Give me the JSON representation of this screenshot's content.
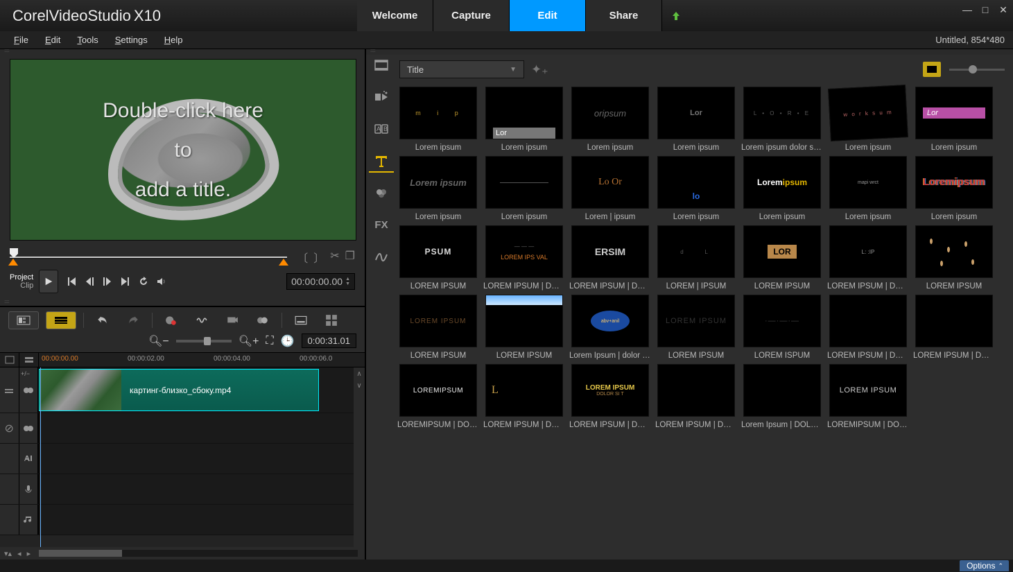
{
  "app": {
    "brand": "Corel",
    "name1": "Video",
    "name2": "Studio",
    "version": "X10"
  },
  "modes": {
    "welcome": "Welcome",
    "capture": "Capture",
    "edit": "Edit",
    "share": "Share"
  },
  "menu": {
    "file": "File",
    "edit": "Edit",
    "tools": "Tools",
    "settings": "Settings",
    "help": "Help"
  },
  "project_info": "Untitled, 854*480",
  "preview": {
    "line1": "Double-click here",
    "line2": "to",
    "line3": "add a title.",
    "mode_project": "Project",
    "mode_clip": "Clip",
    "timecode": "00:00:00.00"
  },
  "timeline": {
    "duration": "0:00:31.01",
    "ruler": {
      "t0": "00:00:00.00",
      "t1": "00:00:02.00",
      "t2": "00:00:04.00",
      "t3": "00:00:06.0"
    },
    "clip1_name": "картинг-близко_сбоку.mp4",
    "addtrack": "+/−"
  },
  "library": {
    "category": "Title",
    "items": [
      {
        "label": "Lorem ipsum"
      },
      {
        "label": "Lorem ipsum"
      },
      {
        "label": "Lorem ipsum"
      },
      {
        "label": "Lorem ipsum"
      },
      {
        "label": "Lorem ipsum dolor sit a…"
      },
      {
        "label": "Lorem ipsum"
      },
      {
        "label": "Lorem ipsum"
      },
      {
        "label": "Lorem ipsum"
      },
      {
        "label": "Lorem ipsum"
      },
      {
        "label": "Lorem | ipsum"
      },
      {
        "label": "Lorem ipsum"
      },
      {
        "label": "Lorem ipsum"
      },
      {
        "label": "Lorem ipsum"
      },
      {
        "label": "Lorem ipsum"
      },
      {
        "label": "LOREM IPSUM"
      },
      {
        "label": "LOREM IPSUM | DOL…"
      },
      {
        "label": "LOREM IPSUM | DOL…"
      },
      {
        "label": "LOREM | IPSUM"
      },
      {
        "label": "LOREM IPSUM"
      },
      {
        "label": "LOREM IPSUM | DOL…"
      },
      {
        "label": "LOREM IPSUM"
      },
      {
        "label": "LOREM IPSUM"
      },
      {
        "label": "LOREM IPSUM"
      },
      {
        "label": "Lorem Ipsum |  dolor sit …"
      },
      {
        "label": "LOREM IPSUM"
      },
      {
        "label": "LOREM ISPUM"
      },
      {
        "label": "LOREM IPSUM | DOL…"
      },
      {
        "label": "LOREM IPSUM | DOL…"
      },
      {
        "label": "LOREMIPSUM | DOLO…"
      },
      {
        "label": "LOREM IPSUM | DOL…"
      },
      {
        "label": "LOREM IPSUM | DOL…"
      },
      {
        "label": "LOREM IPSUM | DOL…"
      },
      {
        "label": "Lorem Ipsum | DOLOR …"
      },
      {
        "label": "LOREMIPSUM | DOL…"
      }
    ]
  },
  "thumb_text": {
    "r1t2": "Lor",
    "r1t3": "оripsum",
    "r1t4": "Lor",
    "r1t7": "Lor",
    "r2t1": "Lorem ipsum",
    "r2t3": "Lo  Or",
    "r2t4": "lo",
    "r2t5a": "Lorem ",
    "r2t5b": "ipsum",
    "r2t7a": "Lorem",
    "r2t7b": "ipsum",
    "r3t1": "PSUM",
    "r3t2b": "LOREM IPS VAL",
    "r3t3": "ERSIM",
    "r3t5": "LOR",
    "r4t1": "LOREM IPSUM",
    "r5t1": "LOREMIPSUM",
    "r5t2": "L",
    "r5t3a": "LOREM IPSUM",
    "r5t3b": "DOLOR SI T",
    "r5t6": "LOREM IPSUM"
  },
  "footer": {
    "options": "Options"
  }
}
